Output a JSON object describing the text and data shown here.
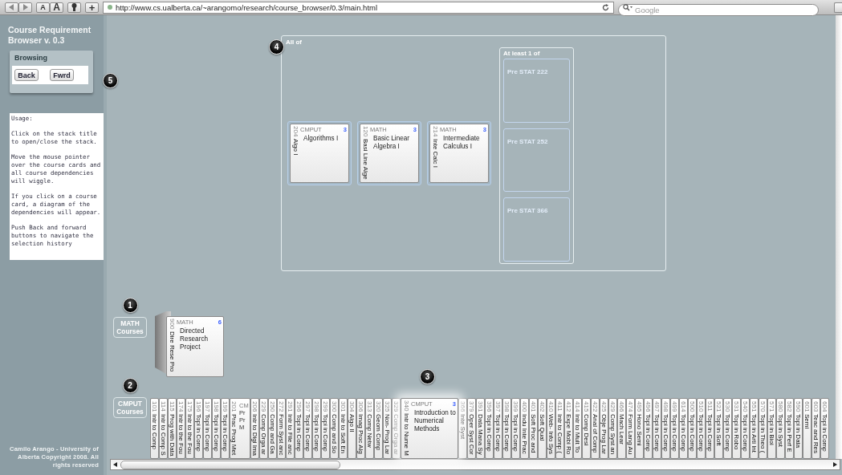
{
  "browser": {
    "text_smaller": "A",
    "text_larger": "A",
    "add": "+",
    "url": "http://www.cs.ualberta.ca/~arangomo/research/course_browser/0.3/main.html",
    "search_placeholder": "Google"
  },
  "sidebar": {
    "title": "Course Requirement Browser v. 0.3",
    "browsing": {
      "title": "Browsing",
      "buttons": [
        "Back",
        "Fwrd"
      ],
      "callout": "5"
    },
    "usage": [
      "Usage:",
      "Click on the stack title to open/close the stack.",
      "Move the mouse pointer over the course cards and all course dependencies will wiggle.",
      "If you click on a course card, a diagram of the dependencies will appear.",
      "Push Back and forward buttons to navigate the selection history"
    ],
    "footer": "Camilo Arango - University of Alberta Copyright 2008. All rights reserved"
  },
  "diagram": {
    "callout": "4",
    "label": "All of",
    "cards": [
      {
        "dept": "CMPUT",
        "num": "204",
        "credits": "3",
        "short": "Algo I",
        "title": "Algorithms I"
      },
      {
        "dept": "MATH",
        "num": "120",
        "credits": "3",
        "short": "Basi Line Alge",
        "title": "Basic Linear Algebra I"
      },
      {
        "dept": "MATH",
        "num": "214",
        "credits": "3",
        "short": "Inte Calc I",
        "title": "Intermediate Calculus I"
      }
    ],
    "alternatives": {
      "label": "At least 1 of",
      "items": [
        "Pre STAT 222",
        "Pre STAT 252",
        "Pre STAT 366"
      ]
    }
  },
  "stacks": [
    {
      "label": "MATH Courses",
      "callout": "1",
      "cards": [
        {
          "kind": "open",
          "dept": "MATH",
          "num": "900",
          "credits": "6",
          "short": "Dire Rese Pro",
          "title": "Directed Research Project"
        }
      ]
    },
    {
      "label": "CMPUT Courses",
      "callout": "2",
      "cards": [
        {
          "kind": "spine",
          "num": "101",
          "short": "Intr to Comp"
        },
        {
          "kind": "spine",
          "num": "114",
          "short": "Intr to Comp S"
        },
        {
          "kind": "spine",
          "num": "115",
          "short": "Prog with Data"
        },
        {
          "kind": "spine",
          "num": "174",
          "short": "Intr to the Fou"
        },
        {
          "kind": "spine",
          "num": "175",
          "short": "Intr to the Fou"
        },
        {
          "kind": "spine",
          "num": "196",
          "short": "Topi in Comp"
        },
        {
          "kind": "spine",
          "num": "197",
          "short": "Topi in Comp"
        },
        {
          "kind": "spine",
          "num": "198",
          "short": "Topi in Comp"
        },
        {
          "kind": "spine",
          "num": "199",
          "short": "Topi in Comp"
        },
        {
          "kind": "peek",
          "num": "201",
          "short": "Prac Prog Met",
          "head": "CM",
          "lines": [
            "Pr",
            "Pr",
            "M"
          ]
        },
        {
          "kind": "spine",
          "num": "206",
          "short": "Intr to Digi Ima"
        },
        {
          "kind": "spine",
          "num": "229",
          "short": "Comp Orga ar"
        },
        {
          "kind": "spine",
          "num": "250",
          "short": "Comp and Ga"
        },
        {
          "kind": "spine",
          "num": "272",
          "short": "Form Syst anc"
        },
        {
          "kind": "spine",
          "num": "291",
          "short": "Intr to File anc"
        },
        {
          "kind": "spine",
          "num": "296",
          "short": "Topi in Comp"
        },
        {
          "kind": "spine",
          "num": "297",
          "short": "Topi in Comp"
        },
        {
          "kind": "spine",
          "num": "298",
          "short": "Topi in Comp"
        },
        {
          "kind": "spine",
          "num": "299",
          "short": "Topi in Comp"
        },
        {
          "kind": "spine",
          "num": "300",
          "short": "Comp and So"
        },
        {
          "kind": "spine",
          "num": "301",
          "short": "Intr to Soft En"
        },
        {
          "kind": "spine",
          "num": "304",
          "short": "Algo II"
        },
        {
          "kind": "spine",
          "num": "306",
          "short": "Imag Proc Alg"
        },
        {
          "kind": "spine",
          "num": "313",
          "short": "Comp Netw"
        },
        {
          "kind": "spine",
          "num": "320",
          "short": "Geom Comp"
        },
        {
          "kind": "spine",
          "num": "325",
          "short": "Non- Prog Lar"
        },
        {
          "kind": "faded",
          "num": "329",
          "short": "Comp Orga ar"
        },
        {
          "kind": "open",
          "dept": "CMPUT",
          "num": "340",
          "credits": "3",
          "short": "Intr to Nume M",
          "title": "Introduction to Numerical Methods",
          "callout": "3"
        },
        {
          "kind": "spine",
          "num": "366",
          "short": "Inte Syst"
        },
        {
          "kind": "spine",
          "num": "379",
          "short": "Oper Syst Cor"
        },
        {
          "kind": "spine",
          "num": "391",
          "short": "Data Mana Sy"
        },
        {
          "kind": "spine",
          "num": "396",
          "short": "Topi in Comp"
        },
        {
          "kind": "spine",
          "num": "397",
          "short": "Topi in Comp"
        },
        {
          "kind": "spine",
          "num": "398",
          "short": "Topi in Comp"
        },
        {
          "kind": "spine",
          "num": "399",
          "short": "Topi in Comp"
        },
        {
          "kind": "spine",
          "num": "400",
          "short": "Indu Inte Prac"
        },
        {
          "kind": "spine",
          "num": "401",
          "short": "Soft Proc and"
        },
        {
          "kind": "spine",
          "num": "402",
          "short": "Soft Qual"
        },
        {
          "kind": "spine",
          "num": "410",
          "short": "Web- Info Sys"
        },
        {
          "kind": "spine",
          "num": "411",
          "short": "Intr to Comp ("
        },
        {
          "kind": "spine",
          "num": "412",
          "short": "Expe Mobi Ro"
        },
        {
          "kind": "spine",
          "num": "414",
          "short": "Intr to Mult To"
        },
        {
          "kind": "spine",
          "num": "415",
          "short": "Comp Desi"
        },
        {
          "kind": "spine",
          "num": "422",
          "short": "Anal of Comp"
        },
        {
          "kind": "spine",
          "num": "425",
          "short": "Obje Prog Lar"
        },
        {
          "kind": "spine",
          "num": "429",
          "short": "Comp Syst an"
        },
        {
          "kind": "spine",
          "num": "466",
          "short": "Mach Lear"
        },
        {
          "kind": "spine",
          "num": "474",
          "short": "Form Lang Au"
        },
        {
          "kind": "spine",
          "num": "495",
          "short": "Hono Semi"
        },
        {
          "kind": "spine",
          "num": "496",
          "short": "Topi in Comp"
        },
        {
          "kind": "spine",
          "num": "497",
          "short": "Topi in Comp"
        },
        {
          "kind": "spine",
          "num": "498",
          "short": "Topi in Comp"
        },
        {
          "kind": "spine",
          "num": "499",
          "short": "Topi in Comp"
        },
        {
          "kind": "spine",
          "num": "614",
          "short": "Topi in Comp"
        },
        {
          "kind": "spine",
          "num": "500",
          "short": "Topi in Comp"
        },
        {
          "kind": "spine",
          "num": "510",
          "short": "Topi in Comp"
        },
        {
          "kind": "spine",
          "num": "511",
          "short": "Topi in Comp"
        },
        {
          "kind": "spine",
          "num": "521",
          "short": "Topi in Soft"
        },
        {
          "kind": "spine",
          "num": "530",
          "short": "Topi in Comp"
        },
        {
          "kind": "spine",
          "num": "531",
          "short": "Topi in Robo"
        },
        {
          "kind": "spine",
          "num": "540",
          "short": "Topi in Comp"
        },
        {
          "kind": "spine",
          "num": "551",
          "short": "Topi in Arti Int"
        },
        {
          "kind": "spine",
          "num": "570",
          "short": "Topi in Theo ("
        },
        {
          "kind": "spine",
          "num": "571",
          "short": "Topi in Bioi"
        },
        {
          "kind": "spine",
          "num": "580",
          "short": "Topi in Syst"
        },
        {
          "kind": "spine",
          "num": "582",
          "short": "Topi in Perf E"
        },
        {
          "kind": "spine",
          "num": "590",
          "short": "Topi in Data"
        },
        {
          "kind": "spine",
          "num": "601",
          "short": "Semi"
        },
        {
          "kind": "spine",
          "num": "603",
          "short": "Teac and Res"
        },
        {
          "kind": "spine",
          "num": "604",
          "short": "Topi in Comp"
        }
      ]
    }
  ]
}
